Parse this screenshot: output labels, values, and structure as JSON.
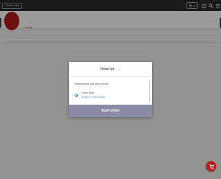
{
  "topbar": {
    "back_label": "Back to App",
    "cart_count": "0",
    "account_icon": "user-circle-icon",
    "search_icon": "search-icon",
    "menu_icon": "hamburger-menu-icon"
  },
  "store_header": {
    "link_label": "⌂ Details"
  },
  "modal": {
    "title": "Order for",
    "question": "When would you like to order",
    "option_title": "Order Now",
    "option_subtitle": "Ready in ~tooth minutes",
    "start_button": "Start Order"
  },
  "floating_cart": {
    "icon": "shopping-cart-icon"
  },
  "colors": {
    "topbar": "#2b2b2b",
    "brand_red": "#b31b1b",
    "button_purple": "#8b8ba6",
    "link_blue": "#5a8fc0"
  }
}
